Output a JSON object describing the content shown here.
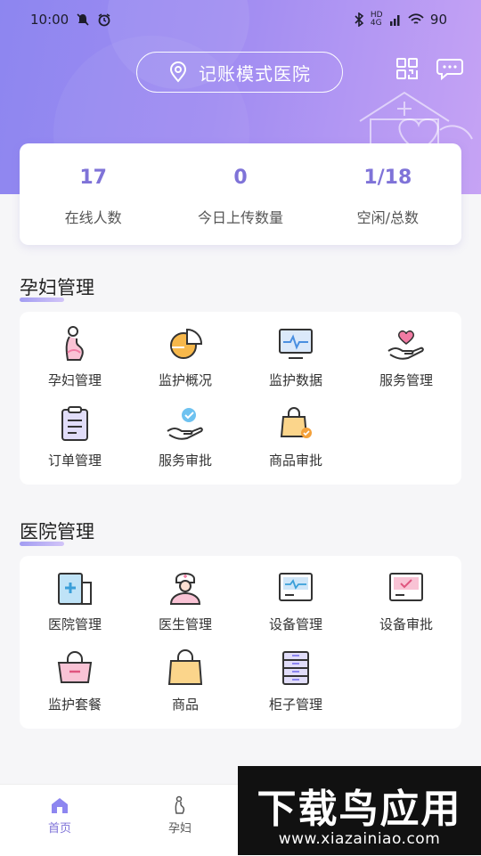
{
  "status_bar": {
    "time": "10:00",
    "battery": "90",
    "network": "HD 4G"
  },
  "header": {
    "hospital_name": "记账模式医院"
  },
  "stats": [
    {
      "value": "17",
      "label": "在线人数"
    },
    {
      "value": "0",
      "label": "今日上传数量"
    },
    {
      "value": "1/18",
      "label": "空闲/总数"
    }
  ],
  "sections": {
    "pregnant": {
      "title": "孕妇管理",
      "items": [
        {
          "label": "孕妇管理",
          "icon": "pregnant-woman-icon"
        },
        {
          "label": "监护概况",
          "icon": "pie-chart-icon"
        },
        {
          "label": "监护数据",
          "icon": "monitor-data-icon"
        },
        {
          "label": "服务管理",
          "icon": "heart-hand-icon"
        },
        {
          "label": "订单管理",
          "icon": "clipboard-icon"
        },
        {
          "label": "服务审批",
          "icon": "approve-hand-icon"
        },
        {
          "label": "商品审批",
          "icon": "bag-check-icon"
        }
      ]
    },
    "hospital": {
      "title": "医院管理",
      "items": [
        {
          "label": "医院管理",
          "icon": "hospital-icon"
        },
        {
          "label": "医生管理",
          "icon": "doctor-icon"
        },
        {
          "label": "设备管理",
          "icon": "device-icon"
        },
        {
          "label": "设备审批",
          "icon": "device-approve-icon"
        },
        {
          "label": "监护套餐",
          "icon": "package-icon"
        },
        {
          "label": "商品",
          "icon": "shopping-bag-icon"
        },
        {
          "label": "柜子管理",
          "icon": "cabinet-icon"
        }
      ]
    }
  },
  "tabbar": [
    {
      "label": "首页",
      "active": true
    },
    {
      "label": "孕妇",
      "active": false
    }
  ],
  "watermark": {
    "brand": "下载鸟应用",
    "url": "www.xiazainiao.com"
  },
  "colors": {
    "primary": "#8d86f0",
    "accent": "#7f73d8",
    "pink": "#f17ba3",
    "orange": "#f4a13a"
  }
}
